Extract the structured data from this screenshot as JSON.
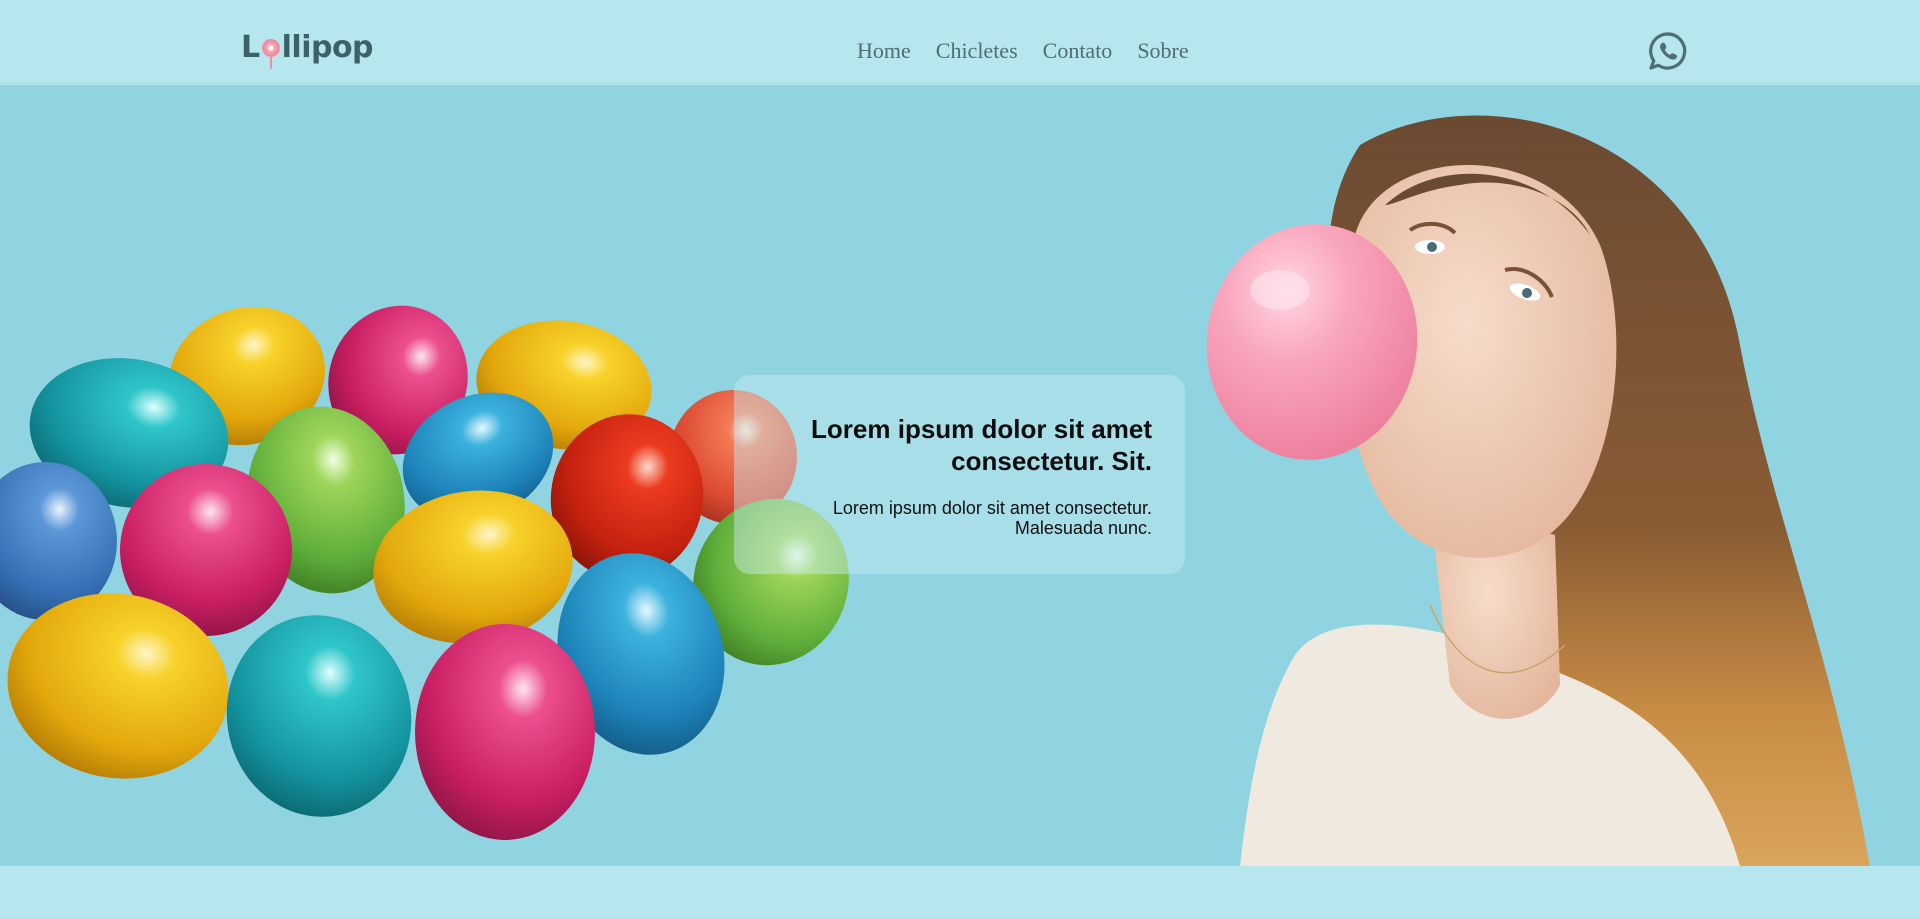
{
  "header": {
    "logo": {
      "prefix": "L",
      "suffix": "llipop",
      "icon": "lollipop-icon"
    },
    "nav": [
      {
        "label": "Home"
      },
      {
        "label": "Chicletes"
      },
      {
        "label": "Contato"
      },
      {
        "label": "Sobre"
      }
    ],
    "contact_icon": "whatsapp-icon"
  },
  "hero": {
    "title": "Lorem ipsum dolor sit amet consectetur. Sit.",
    "text": "Lorem ipsum dolor sit amet consectetur. Malesuada nunc.",
    "left_image": "colorful-easter-eggs",
    "right_image": "woman-blowing-bubble-gum"
  },
  "colors": {
    "header_bg": "#b6e7ee",
    "hero_bg": "#8fd4e0",
    "text_dark": "#3d6168",
    "accent_pink": "#ee8fa4"
  }
}
